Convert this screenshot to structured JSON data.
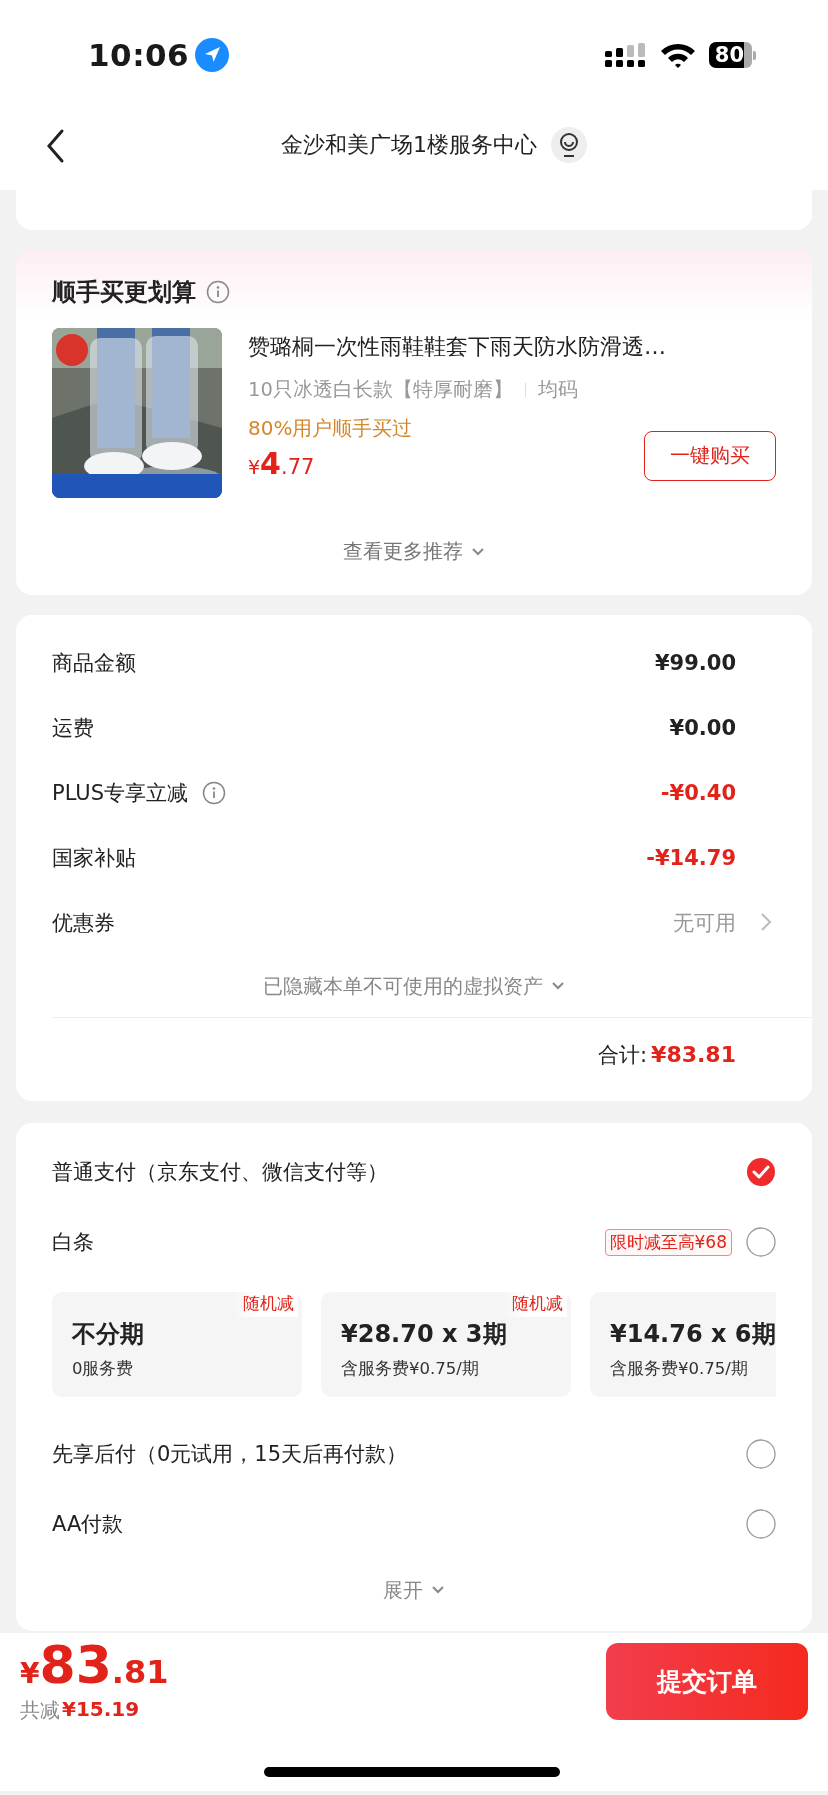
{
  "status_bar": {
    "time": "10:06",
    "battery": "80"
  },
  "header": {
    "title": "金沙和美广场1楼服务中心"
  },
  "recommend": {
    "title": "顺手买更划算",
    "product": {
      "name": "赞璐桐一次性雨鞋鞋套下雨天防水防滑透…",
      "spec": "10只冰透白长款【特厚耐磨】",
      "size": "均码",
      "social_proof": "80%用户顺手买过",
      "price_currency": "¥",
      "price_integer": "4",
      "price_decimal": ".77",
      "buy_button": "一键购买"
    },
    "more": "查看更多推荐"
  },
  "summary": {
    "rows": [
      {
        "label": "商品金额",
        "value": "¥99.00",
        "kind": "plain",
        "info": false
      },
      {
        "label": "运费",
        "value": "¥0.00",
        "kind": "plain",
        "info": false
      },
      {
        "label": "PLUS专享立减",
        "value": "-¥0.40",
        "kind": "discount",
        "info": true
      },
      {
        "label": "国家补贴",
        "value": "-¥14.79",
        "kind": "discount",
        "info": false
      },
      {
        "label": "优惠券",
        "value": "无可用",
        "kind": "link",
        "info": false
      }
    ],
    "hidden_note": "已隐藏本单不可使用的虚拟资产",
    "total_label": "合计:",
    "total_value": "¥83.81"
  },
  "payment": {
    "methods": [
      {
        "label": "普通支付（京东支付、微信支付等）",
        "selected": true
      },
      {
        "label": "白条",
        "selected": false,
        "badge": "限时减至高¥68",
        "installments": [
          {
            "title": "不分期",
            "sub": "0服务费",
            "badge": "随机减"
          },
          {
            "title": "¥28.70 x 3期",
            "sub": "含服务费¥0.75/期",
            "badge": "随机减"
          },
          {
            "title": "¥14.76 x 6期",
            "sub": "含服务费¥0.75/期"
          }
        ]
      },
      {
        "label": "先享后付（0元试用，15天后再付款）",
        "selected": false
      },
      {
        "label": "AA付款",
        "selected": false
      }
    ],
    "expand": "展开"
  },
  "footer": {
    "price_currency": "¥",
    "price_integer": "83",
    "price_decimal": ".81",
    "saved_label": "共减",
    "saved_value": "¥15.19",
    "submit": "提交订单"
  }
}
